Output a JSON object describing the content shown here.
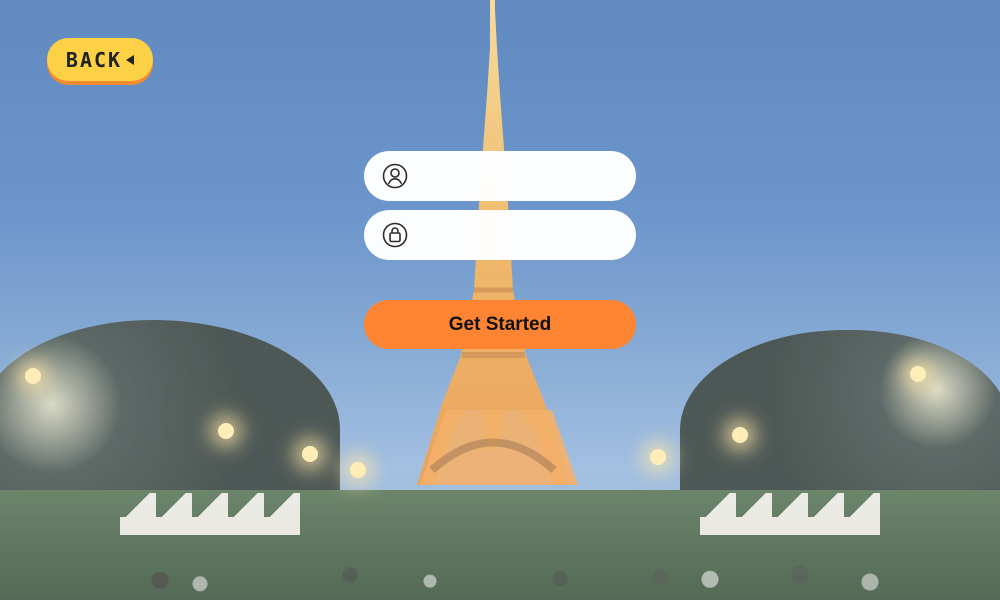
{
  "page": {
    "background": "paris-eiffel-tower-evening"
  },
  "back_button": {
    "label": "BACK",
    "icon": "arrow-left-icon",
    "accent": "#fdd146",
    "shadow": "#f28b32"
  },
  "form": {
    "username_field": {
      "icon": "user-icon",
      "value": "",
      "placeholder": ""
    },
    "password_field": {
      "icon": "lock-icon",
      "value": "",
      "placeholder": ""
    },
    "submit_button": {
      "label": "Get Started",
      "color": "#fd8433"
    }
  }
}
